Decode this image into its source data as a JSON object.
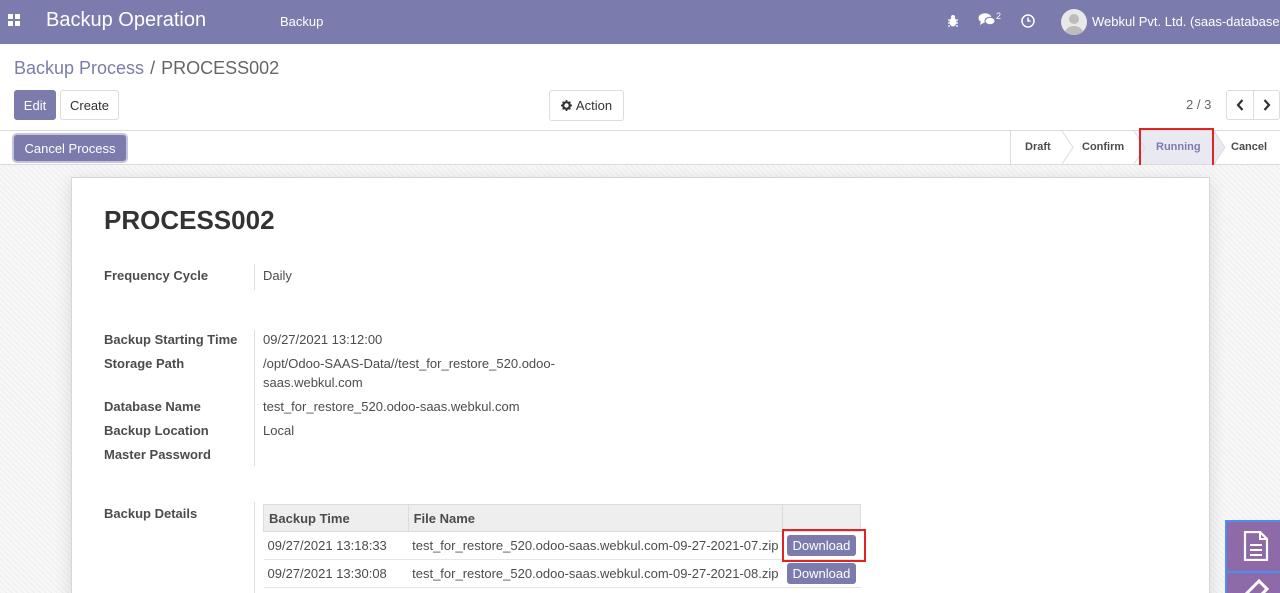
{
  "navbar": {
    "app_title": "Backup Operation",
    "menu_item": "Backup",
    "chat_count": "2",
    "company": "Webkul Pvt. Ltd. (saas-database)"
  },
  "breadcrumb": {
    "parent": "Backup Process",
    "separator": "/",
    "current": "PROCESS002"
  },
  "toolbar": {
    "edit_label": "Edit",
    "create_label": "Create",
    "action_label": "Action",
    "pager": "2 / 3"
  },
  "statusbar": {
    "cancel_process_label": "Cancel Process",
    "stages": [
      {
        "label": "Draft",
        "active": false
      },
      {
        "label": "Confirm",
        "active": false
      },
      {
        "label": "Running",
        "active": true
      },
      {
        "label": "Cancel",
        "active": false
      }
    ]
  },
  "record": {
    "title": "PROCESS002",
    "fields": {
      "frequency_cycle": {
        "label": "Frequency Cycle",
        "value": "Daily"
      },
      "backup_starting_time": {
        "label": "Backup Starting Time",
        "value": "09/27/2021 13:12:00"
      },
      "storage_path": {
        "label": "Storage Path",
        "value_line1": "/opt/Odoo-SAAS-Data//test_for_restore_520.odoo-",
        "value_line2": "saas.webkul.com"
      },
      "database_name": {
        "label": "Database Name",
        "value": "test_for_restore_520.odoo-saas.webkul.com"
      },
      "backup_location": {
        "label": "Backup Location",
        "value": "Local"
      },
      "master_password": {
        "label": "Master Password",
        "value": ""
      },
      "backup_details": {
        "label": "Backup Details"
      }
    },
    "backup_table": {
      "columns": [
        "Backup Time",
        "File Name",
        ""
      ],
      "rows": [
        {
          "time": "09/27/2021 13:18:33",
          "file": "test_for_restore_520.odoo-saas.webkul.com-09-27-2021-07.zip",
          "action": "Download"
        },
        {
          "time": "09/27/2021 13:30:08",
          "file": "test_for_restore_520.odoo-saas.webkul.com-09-27-2021-08.zip",
          "action": "Download"
        }
      ]
    }
  },
  "colors": {
    "brand": "#7c7bad",
    "highlight": "#e02424",
    "side_widget": "#8e6aa8"
  }
}
